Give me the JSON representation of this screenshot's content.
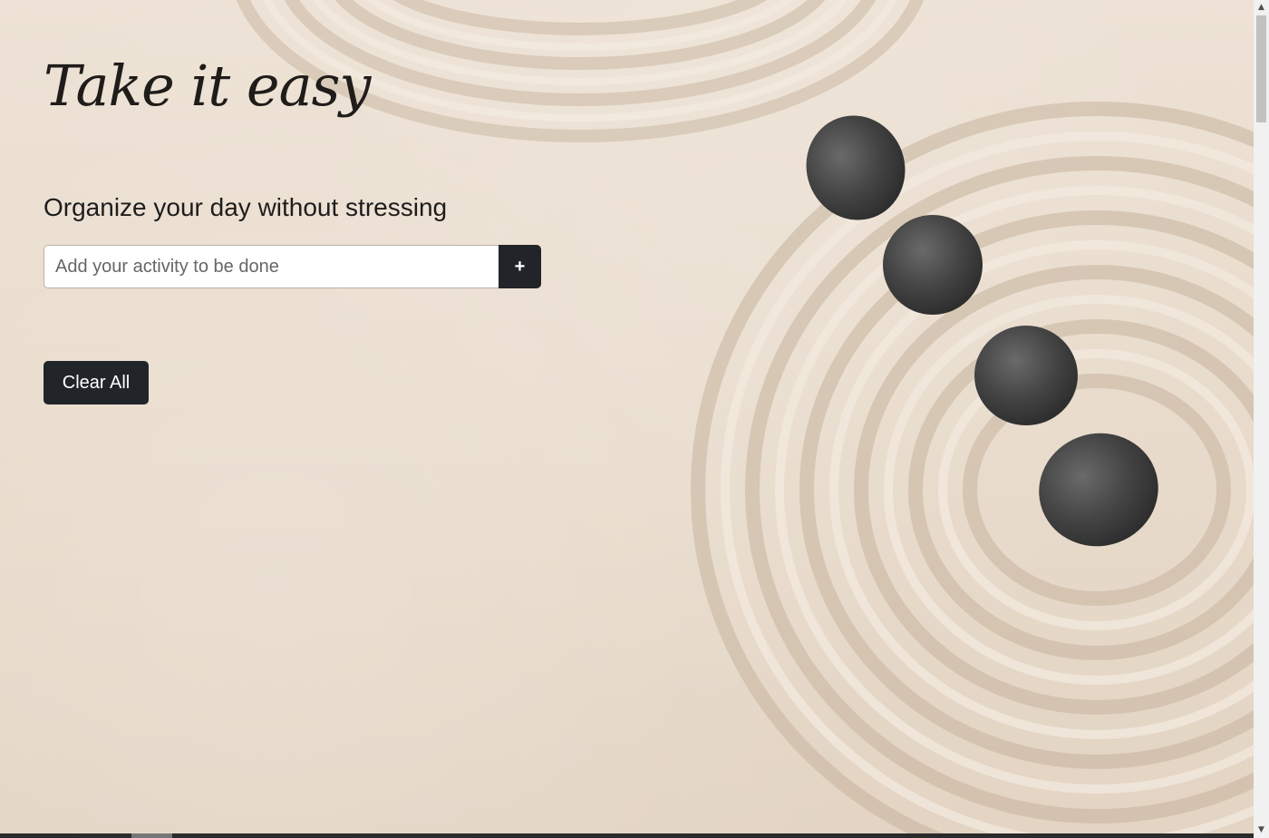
{
  "app": {
    "title": "Take it easy",
    "subtitle": "Organize your day without stressing"
  },
  "todo_form": {
    "placeholder": "Add your activity to be done",
    "value": "",
    "add_label": "+"
  },
  "actions": {
    "clear_all_label": "Clear All"
  },
  "colors": {
    "button_bg": "#212529",
    "button_text": "#ffffff",
    "sand": "#e9dccd",
    "stone": "#4a4a4a"
  },
  "scrollbar": {
    "up_arrow": "▲",
    "down_arrow": "▼"
  },
  "background": {
    "icon": "zen-sand-stones-image"
  }
}
